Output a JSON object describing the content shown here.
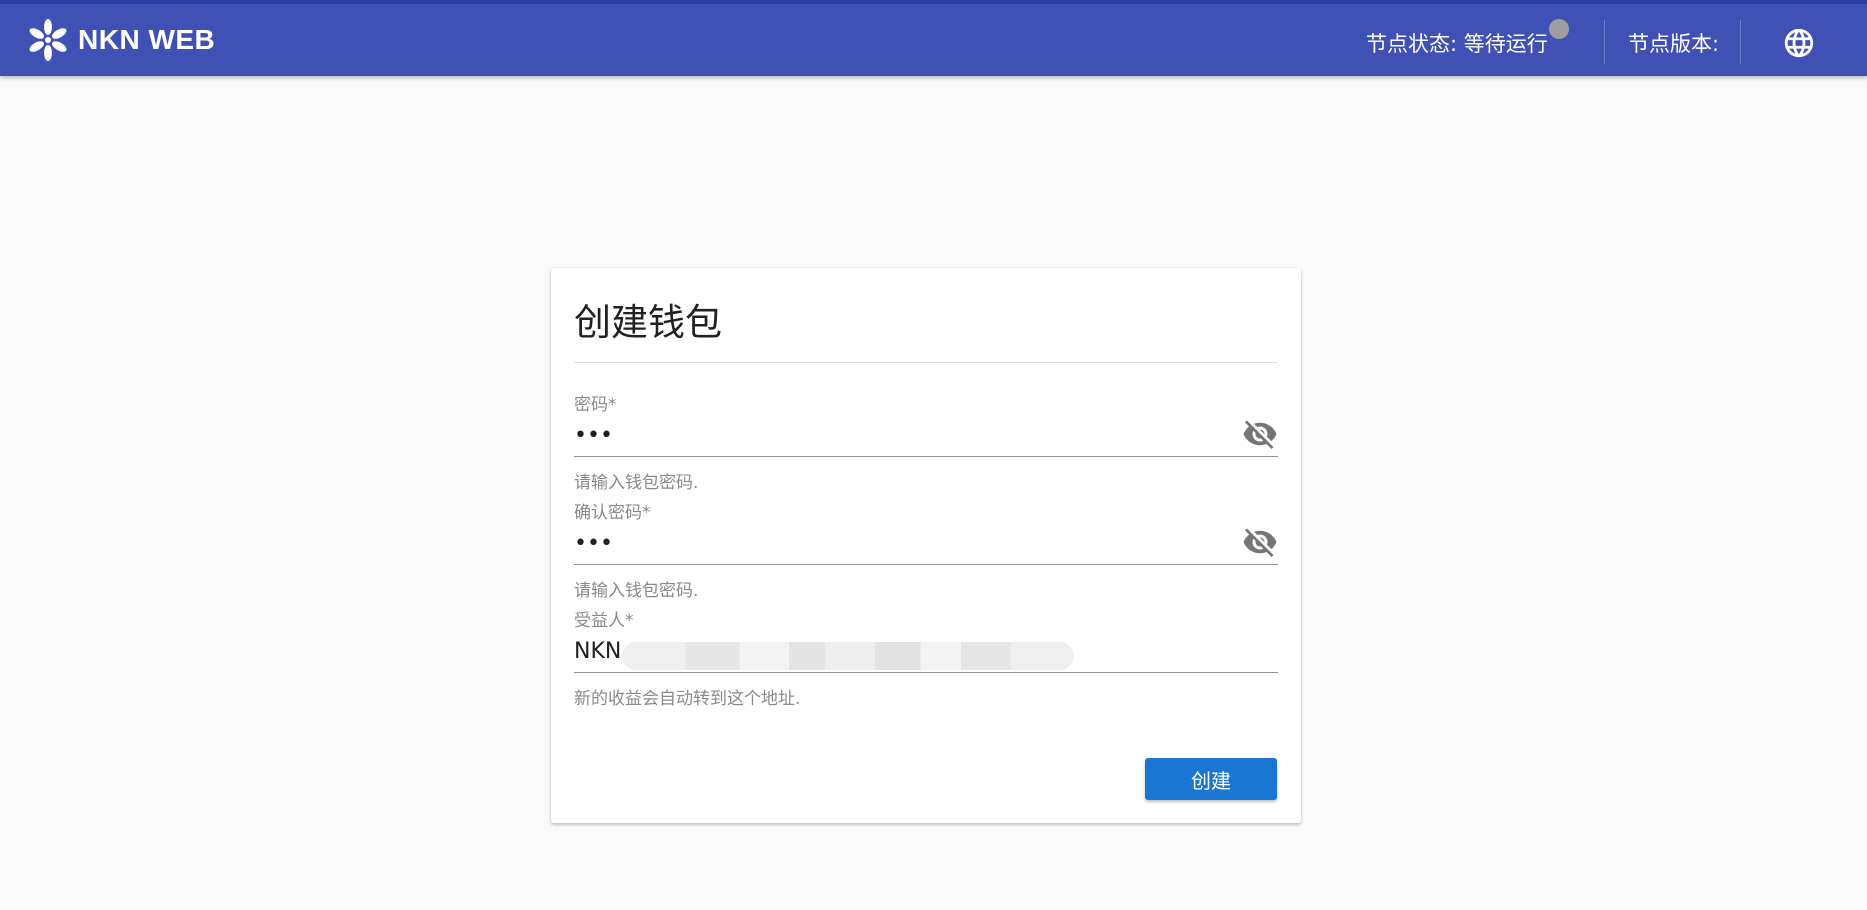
{
  "app": {
    "brand": "NKN WEB",
    "status_label": "节点状态: 等待运行",
    "status_color": "#9e9e9e",
    "version_label": "节点版本:",
    "bar_color": "#3f51b5"
  },
  "form": {
    "title": "创建钱包",
    "password": {
      "label": "密码*",
      "value": "•••",
      "hint": "请输入钱包密码."
    },
    "confirm_password": {
      "label": "确认密码*",
      "value": "•••",
      "hint": "请输入钱包密码."
    },
    "beneficiary": {
      "label": "受益人*",
      "value": "NKN",
      "hint": "新的收益会自动转到这个地址."
    },
    "submit_label": "创建",
    "submit_color": "#1976d2"
  },
  "icons": {
    "logo": "nkn-logo-icon",
    "language": "globe-icon",
    "password_visibility": "eye-off-icon"
  }
}
